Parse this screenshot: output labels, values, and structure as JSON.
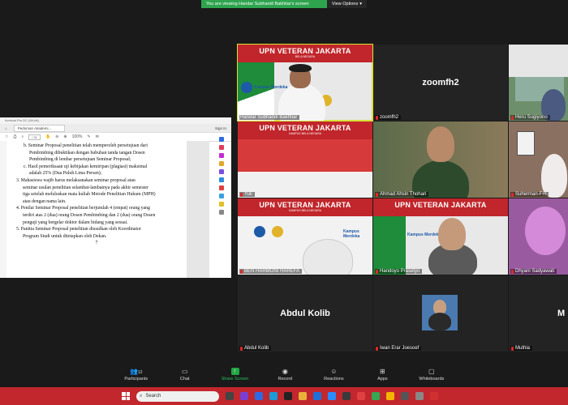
{
  "banner": {
    "message": "You are viewing Handar Subhandi Bakhtiar's screen",
    "view_options": "View Options"
  },
  "document": {
    "window_title": "Acrobat Pro DC (64-bit)",
    "tab": "Pedoman Akademi...",
    "sign_in": "Sign In",
    "page_box": "/ 31",
    "zoom": "100%",
    "lines": [
      "b.  Seminar Proposal penelitian telah memperoleh persetujuan dari",
      "Pembimbing dibuktikan dengan bubuhan tanda tangan Dosen",
      "Pembimbing di lembar persetujuan Seminar Proposal;",
      "c.  Hasil pemeriksaan uji kebijakan kemiripan (plagiasi) maksimal",
      "adalah 25% (Dua Puluh Lima Persen);",
      "3.  Mahasiswa wajib harus melaksanakan seminar proposal atau",
      "seminar usulan penelitian selambat-lambatnya pada akhir semester",
      "tiga setelah meluluskan mata kuliah Metode Penelitian Hukum (MPH)",
      "atau dengan nama lain.",
      "4.  Penilai Seminar Proposal penelitian berjumlah 4 (empat) orang yang",
      "terdiri atas 2 (dua) orang Dosen Pembimbing dan 2 (dua) orang Dosen",
      "penguji yang bergelar doktor dalam bidang yang sesuai.",
      "5.  Panitia Seminar Proposal penelitian diusulkan oleh Koordinator",
      "Program Studi untuk ditetapkan oleh Dekan."
    ],
    "page_number": "7"
  },
  "tiles": [
    {
      "name": "Handar Subhandi Bakhtiar",
      "banner": "UPN VETERAN JAKARTA",
      "sub": "BELA NEGARA",
      "label": "Kampus Merdeka",
      "active": true
    },
    {
      "name": "zoomfh2",
      "big": "zoomfh2"
    },
    {
      "name": "Heru Sugiyono"
    },
    {
      "name": "Yuli",
      "banner": "UPN VETERAN JAKARTA",
      "sub": "KAMPUS BELA NEGARA"
    },
    {
      "name": "Ahmad Ahsin Thohari"
    },
    {
      "name": "Suherman-FH"
    },
    {
      "name": "BEN HARMONI HAREFA",
      "banner": "UPN VETERAN JAKARTA",
      "sub": "KAMPUS BELA NEGARA",
      "label": "Kampus Merdeka"
    },
    {
      "name": "Handoyo Prasetyo",
      "banner": "UPN VETERAN JAKARTA",
      "label": "Kampus Merdeka"
    },
    {
      "name": "Dhyani Sadyawati"
    },
    {
      "name": "Abdul Kolib",
      "big": "Abdul Kolib"
    },
    {
      "name": "Iwan Erar Joesoef"
    },
    {
      "name": "Muthia",
      "big": "M"
    }
  ],
  "toolbar": {
    "participants": "Participants",
    "participants_count": "12",
    "chat": "Chat",
    "share": "Share Screen",
    "record": "Record",
    "reactions": "Reactions",
    "apps": "Apps",
    "whiteboards": "Whiteboards"
  },
  "taskbar": {
    "search": "Search"
  },
  "colors": {
    "upn_red": "#c0262b",
    "share_green": "#22a845",
    "active_speaker": "#d7e13a",
    "taskbar_red": "#c1272d"
  }
}
